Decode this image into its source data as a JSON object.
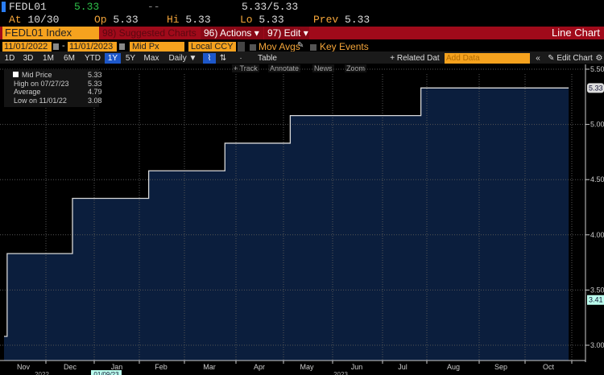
{
  "quote": {
    "ticker": "FEDL01",
    "last": "5.33",
    "change": "--",
    "bid_ask": "5.33/5.33",
    "at_label": "At",
    "at": "10/30",
    "op_label": "Op",
    "op": "5.33",
    "hi_label": "Hi",
    "hi": "5.33",
    "lo_label": "Lo",
    "lo": "5.33",
    "prev_label": "Prev",
    "prev": "5.33"
  },
  "header": {
    "security": "FEDL01 Index",
    "suggested": "98) Suggested Charts",
    "actions": "96) Actions ▾",
    "edit": "97) Edit ▾",
    "chart_type": "Line Chart"
  },
  "controls": {
    "start_date": "11/01/2022",
    "end_date": "11/01/2023",
    "field": "Mid Px",
    "currency": "Local CCY",
    "mov_avgs": "Mov Avgs",
    "key_events": "Key Events"
  },
  "periods": [
    "1D",
    "3D",
    "1M",
    "6M",
    "YTD",
    "1Y",
    "5Y",
    "Max"
  ],
  "selected_period": "1Y",
  "frequency": "Daily ▼",
  "table_label": "Table",
  "related_data": "+ Related Dat",
  "add_data_placeholder": "Add Data",
  "edit_chart": "Edit Chart",
  "tools": [
    "+ Track",
    "Annotate",
    "News",
    "Zoom"
  ],
  "legend": {
    "rows": [
      {
        "label": "Mid Price",
        "value": "5.33"
      },
      {
        "label": "High on 07/27/23",
        "value": "5.33"
      },
      {
        "label": "Average",
        "value": "4.79"
      },
      {
        "label": "Low on 11/01/22",
        "value": "3.08"
      }
    ]
  },
  "hover_date": "01/09/23",
  "year_labels": [
    "2022",
    "2023"
  ],
  "colors": {
    "fill": "#0b1e3d",
    "line": "#d8d8d8",
    "orange": "#f6a21e",
    "red": "#a00a1a"
  },
  "chart_data": {
    "type": "area",
    "title": "",
    "xlim": [
      "2022-11-01",
      "2023-11-01"
    ],
    "ylim": [
      2.9,
      5.55
    ],
    "grid": true,
    "y_ticks": [
      "3.00",
      "3.50",
      "4.00",
      "4.50",
      "5.00",
      "5.50"
    ],
    "x_tick_labels": [
      "Nov",
      "Dec",
      "Jan",
      "Feb",
      "Mar",
      "Apr",
      "May",
      "Jun",
      "Jul",
      "Aug",
      "Sep",
      "Oct"
    ],
    "last_value_label": "5.33",
    "cursor_value_label": "3.41",
    "series": [
      {
        "step": true,
        "points": [
          [
            "2022-11-01",
            3.08
          ],
          [
            "2022-11-03",
            3.83
          ],
          [
            "2022-12-15",
            4.33
          ],
          [
            "2023-02-02",
            4.58
          ],
          [
            "2023-03-23",
            4.83
          ],
          [
            "2023-05-04",
            5.08
          ],
          [
            "2023-07-27",
            5.33
          ],
          [
            "2023-10-30",
            5.33
          ]
        ]
      }
    ]
  }
}
